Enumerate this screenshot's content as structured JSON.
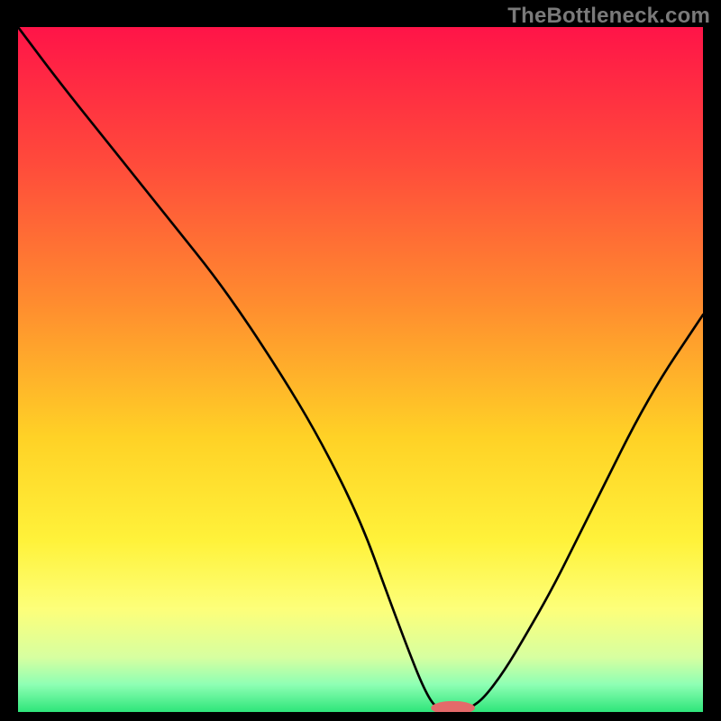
{
  "watermark": "TheBottleneck.com",
  "chart_data": {
    "type": "line",
    "title": "",
    "xlabel": "",
    "ylabel": "",
    "xlim": [
      0,
      100
    ],
    "ylim": [
      0,
      100
    ],
    "grid": false,
    "legend": null,
    "background_gradient_stops": [
      {
        "pos": 0.0,
        "color": "#ff1448"
      },
      {
        "pos": 0.2,
        "color": "#ff4b3b"
      },
      {
        "pos": 0.4,
        "color": "#ff8b2f"
      },
      {
        "pos": 0.6,
        "color": "#ffd226"
      },
      {
        "pos": 0.75,
        "color": "#fff23a"
      },
      {
        "pos": 0.85,
        "color": "#fdff7a"
      },
      {
        "pos": 0.92,
        "color": "#d7ffa0"
      },
      {
        "pos": 0.96,
        "color": "#8effb4"
      },
      {
        "pos": 1.0,
        "color": "#2ee57a"
      }
    ],
    "series": [
      {
        "name": "left-curve",
        "x": [
          0,
          6,
          14,
          22,
          30,
          38,
          44,
          50,
          54,
          57,
          59,
          60.5,
          61.5
        ],
        "y": [
          100,
          92,
          82,
          72,
          62,
          50,
          40,
          28,
          17,
          9,
          4,
          1.2,
          0.6
        ]
      },
      {
        "name": "right-curve",
        "x": [
          66,
          68,
          71,
          74,
          78,
          82,
          86,
          90,
          94,
          98,
          100
        ],
        "y": [
          0.6,
          2,
          6,
          11,
          18,
          26,
          34,
          42,
          49,
          55,
          58
        ]
      }
    ],
    "marker": {
      "name": "min-marker",
      "cx": 63.5,
      "cy": 0.6,
      "rx": 3.2,
      "ry": 1.0,
      "color": "#e46a6a"
    }
  }
}
